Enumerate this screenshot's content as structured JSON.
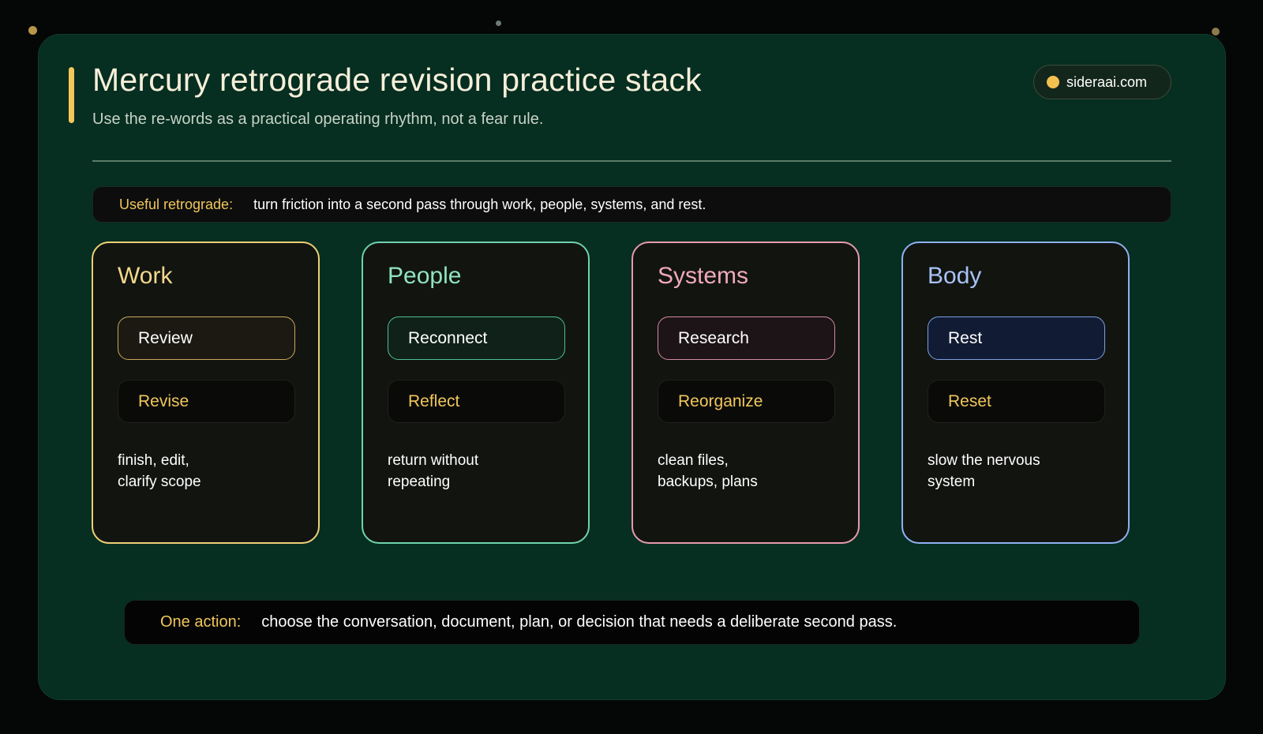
{
  "header": {
    "title": "Mercury retrograde revision practice stack",
    "subtitle": "Use the re-words as a practical operating rhythm, not a fear rule.",
    "site": "sideraai.com"
  },
  "strip": {
    "label": "Useful retrograde:",
    "text": "turn friction into a second pass through work, people, systems, and rest."
  },
  "cards": [
    {
      "title": "Work",
      "primary": "Review",
      "secondary": "Revise",
      "desc": [
        "finish, edit,",
        "clarify scope"
      ],
      "color": "#efcf77"
    },
    {
      "title": "People",
      "primary": "Reconnect",
      "secondary": "Reflect",
      "desc": [
        "return without",
        "repeating"
      ],
      "color": "#6fd3ae"
    },
    {
      "title": "Systems",
      "primary": "Research",
      "secondary": "Reorganize",
      "desc": [
        "clean files,",
        "backups, plans"
      ],
      "color": "#e79aae"
    },
    {
      "title": "Body",
      "primary": "Rest",
      "secondary": "Reset",
      "desc": [
        "slow the nervous",
        "system"
      ],
      "color": "#8fb0f2"
    }
  ],
  "action": {
    "label": "One action:",
    "text": "choose the conversation, document, plan, or decision that needs a deliberate second pass."
  },
  "colors": {
    "accent": "#f2c75c",
    "panel": "#062e21",
    "background": "#050706"
  }
}
